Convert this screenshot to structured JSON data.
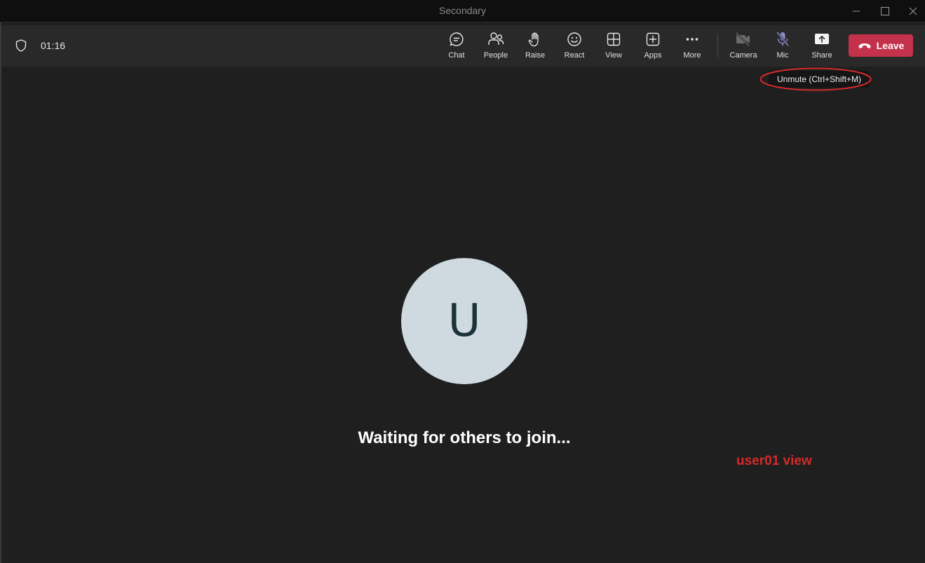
{
  "window": {
    "title": "Secondary",
    "controls": [
      "minimize-icon",
      "maximize-icon",
      "close-icon"
    ]
  },
  "meeting": {
    "timer": "01:16"
  },
  "toolbar": {
    "chat": "Chat",
    "people": "People",
    "raise": "Raise",
    "react": "React",
    "view": "View",
    "apps": "Apps",
    "more": "More",
    "camera": "Camera",
    "mic": "Mic",
    "share": "Share",
    "leave": "Leave"
  },
  "tooltip": {
    "text": "Unmute (Ctrl+Shift+M)"
  },
  "stage": {
    "avatar_initial": "U",
    "status": "Waiting for others to join..."
  },
  "annotation": {
    "label": "user01 view",
    "color": "#d42a2a"
  },
  "colors": {
    "leave_button": "#c4314b",
    "avatar_bg": "#cfd9e0",
    "mic_muted": "#8b8cc7"
  }
}
